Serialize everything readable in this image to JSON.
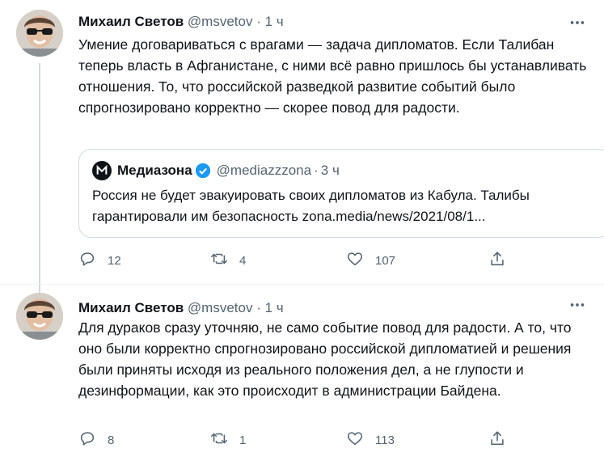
{
  "tweets": [
    {
      "author_name": "Михаил Светов",
      "handle": "@msvetov",
      "separator": "·",
      "time": "1 ч",
      "text": "Умение договариваться с врагами — задача дипломатов. Если Талибан теперь власть в Афганистане, с ними всё равно пришлось бы устанавливать отношения. То, что российской разведкой развитие событий было спрогнозировано корректно — скорее повод для радости.",
      "quote": {
        "author_name": "Медиазона",
        "verified": true,
        "handle": "@mediazzzona",
        "separator": "·",
        "time": "3 ч",
        "text": "Россия не будет эвакуировать своих дипломатов из Кабула. Талибы гарантировали им безопасность zona.media/news/2021/08/1..."
      },
      "replies": "12",
      "retweets": "4",
      "likes": "107"
    },
    {
      "author_name": "Михаил Светов",
      "handle": "@msvetov",
      "separator": "·",
      "time": "1 ч",
      "text": "Для дураков сразу уточняю, не само событие повод для радости. А то, что оно были корректно спрогнозировано российской дипломатией и решения были приняты исходя из реального положения дел, а не глупости и дезинформации, как это происходит в администрации Байдена.",
      "replies": "8",
      "retweets": "1",
      "likes": "113"
    }
  ],
  "icons": {
    "more": "more-horizontal-icon",
    "reply": "reply-icon",
    "retweet": "retweet-icon",
    "like": "heart-icon",
    "share": "share-icon",
    "verified": "verified-badge-icon"
  },
  "colors": {
    "text_primary": "#0f1419",
    "text_secondary": "#536471",
    "verified_blue": "#1d9bf0",
    "border": "#cfd9de"
  }
}
